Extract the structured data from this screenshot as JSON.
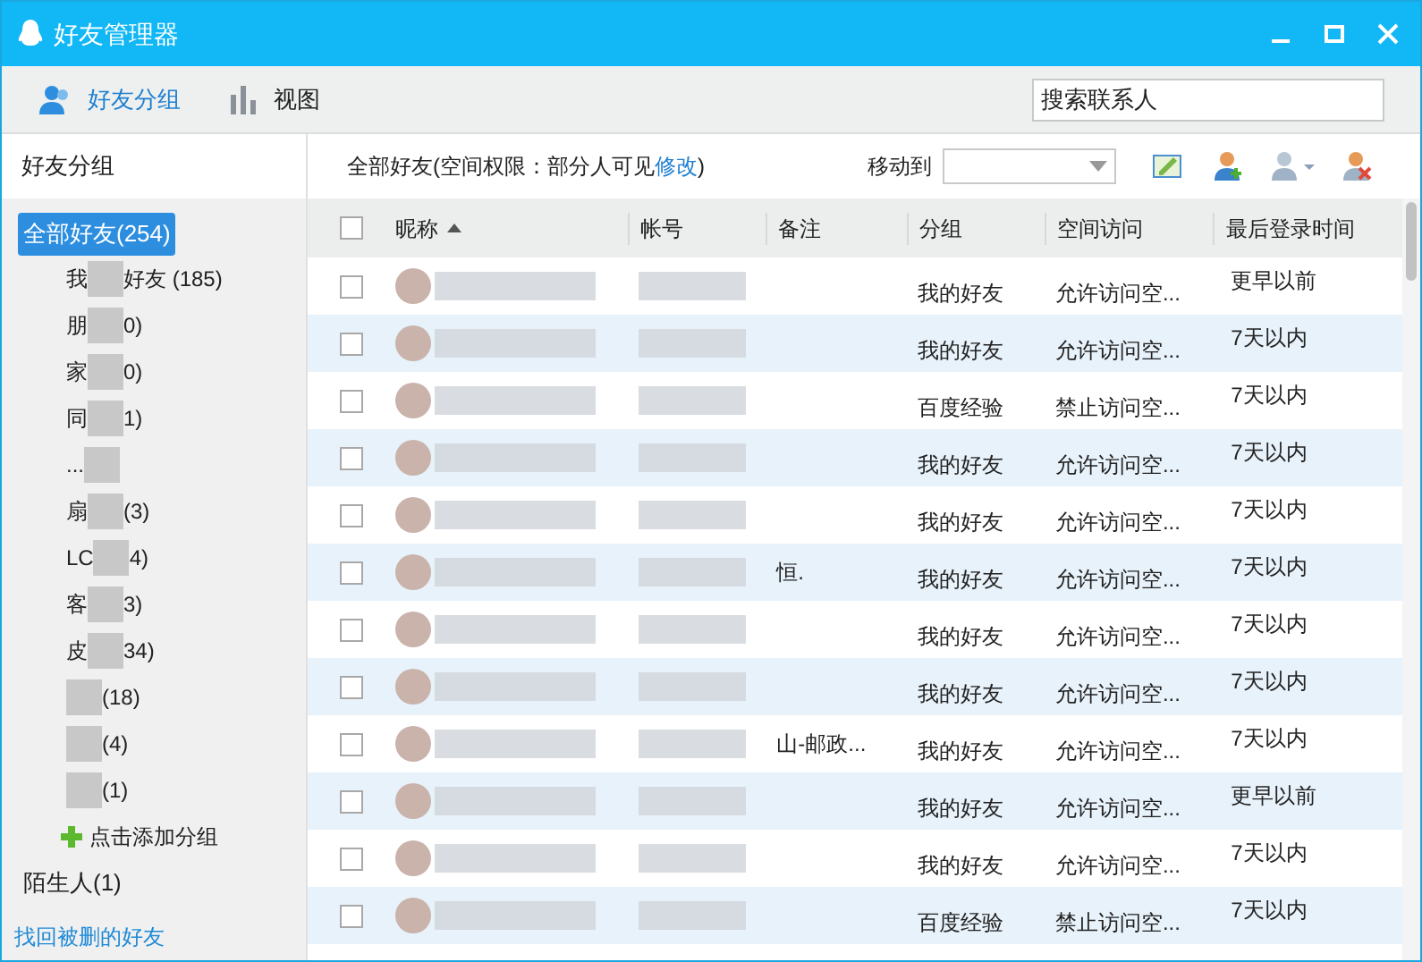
{
  "window": {
    "title": "好友管理器"
  },
  "toolbar": {
    "tabs": [
      {
        "label": "好友分组",
        "selected": true
      },
      {
        "label": "视图",
        "selected": false
      }
    ],
    "search": {
      "placeholder": "搜索联系人"
    }
  },
  "sidebar": {
    "title": "好友分组",
    "all": {
      "label": "全部好友(254)",
      "selected": true
    },
    "groups": [
      {
        "head": "我",
        "tail": "好友 (185)"
      },
      {
        "head": "朋",
        "tail": "0)"
      },
      {
        "head": "家",
        "tail": "0)"
      },
      {
        "head": "同",
        "tail": "1)"
      },
      {
        "head": "..."
      },
      {
        "head": "扇",
        "tail": "(3)"
      },
      {
        "head": "LC",
        "tail": "4)"
      },
      {
        "head": "客",
        "tail": "3)"
      },
      {
        "head": "皮",
        "tail": "34)"
      },
      {
        "tail": "(18)"
      },
      {
        "tail": "(4)"
      },
      {
        "tail": "(1)"
      }
    ],
    "add_group": "点击添加分组",
    "strangers": "陌生人(1)",
    "recover_link": "找回被删的好友"
  },
  "main": {
    "summary_prefix": "全部好友(空间权限：部分人可见",
    "summary_link": "修改",
    "summary_suffix": ")",
    "move_to": "移动到",
    "table": {
      "all_checked": false,
      "columns": [
        "昵称",
        "帐号",
        "备注",
        "分组",
        "空间访问",
        "最后登录时间"
      ],
      "rows": [
        {
          "checked": false,
          "remark": "",
          "group": "我的好友",
          "access": "允许访问空...",
          "last_login": "更早以前"
        },
        {
          "checked": false,
          "remark": "",
          "group": "我的好友",
          "access": "允许访问空...",
          "last_login": "7天以内"
        },
        {
          "checked": false,
          "remark": "",
          "group": "百度经验",
          "access": "禁止访问空...",
          "last_login": "7天以内"
        },
        {
          "checked": false,
          "remark": "",
          "group": "我的好友",
          "access": "允许访问空...",
          "last_login": "7天以内"
        },
        {
          "checked": false,
          "remark": "",
          "group": "我的好友",
          "access": "允许访问空...",
          "last_login": "7天以内"
        },
        {
          "checked": false,
          "remark": "恒.",
          "group": "我的好友",
          "access": "允许访问空...",
          "last_login": "7天以内"
        },
        {
          "checked": false,
          "remark": "",
          "group": "我的好友",
          "access": "允许访问空...",
          "last_login": "7天以内"
        },
        {
          "checked": false,
          "remark": "",
          "group": "我的好友",
          "access": "允许访问空...",
          "last_login": "7天以内"
        },
        {
          "checked": false,
          "remark": "山-邮政...",
          "group": "我的好友",
          "access": "允许访问空...",
          "last_login": "7天以内"
        },
        {
          "checked": false,
          "remark": "",
          "group": "我的好友",
          "access": "允许访问空...",
          "last_login": "更早以前"
        },
        {
          "checked": false,
          "remark": "",
          "group": "我的好友",
          "access": "允许访问空...",
          "last_login": "7天以内"
        },
        {
          "checked": false,
          "remark": "",
          "group": "百度经验",
          "access": "禁止访问空...",
          "last_login": "7天以内"
        }
      ]
    }
  }
}
